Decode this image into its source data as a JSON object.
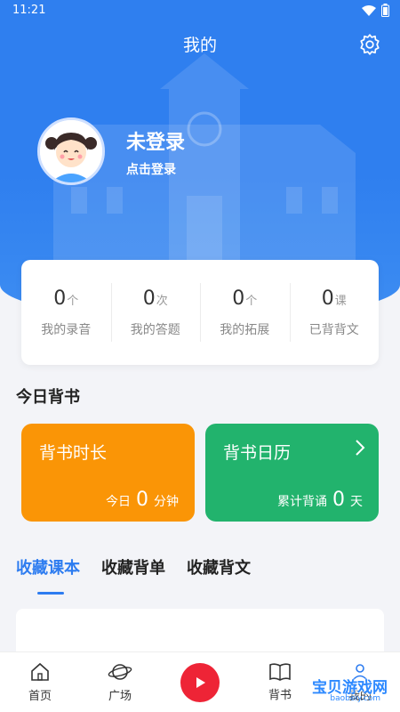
{
  "status_bar": {
    "time": "11:21"
  },
  "header": {
    "title": "我的"
  },
  "profile": {
    "name": "未登录",
    "login_prompt": "点击登录"
  },
  "stats": [
    {
      "value": "0",
      "unit": "个",
      "label": "我的录音"
    },
    {
      "value": "0",
      "unit": "次",
      "label": "我的答题"
    },
    {
      "value": "0",
      "unit": "个",
      "label": "我的拓展"
    },
    {
      "value": "0",
      "unit": "课",
      "label": "已背背文"
    }
  ],
  "today": {
    "title": "今日背书",
    "duration_tile": {
      "title": "背书时长",
      "prefix": "今日",
      "value": "0",
      "unit": "分钟",
      "color": "#fa9506"
    },
    "calendar_tile": {
      "title": "背书日历",
      "prefix": "累计背诵",
      "value": "0",
      "unit": "天",
      "color": "#22b36d"
    }
  },
  "favorites": {
    "tabs": [
      "收藏课本",
      "收藏背单",
      "收藏背文"
    ],
    "active_index": 0
  },
  "bottom_nav": [
    {
      "label": "首页",
      "icon": "home-icon"
    },
    {
      "label": "广场",
      "icon": "planet-icon"
    },
    {
      "label": "",
      "icon": "play-icon"
    },
    {
      "label": "背书",
      "icon": "book-icon"
    },
    {
      "label": "我的",
      "icon": "user-icon"
    }
  ],
  "watermark": {
    "text": "宝贝游戏网",
    "sub": "baobeiy.com"
  },
  "colors": {
    "primary": "#2f7fef",
    "accent_red": "#ee2436"
  }
}
